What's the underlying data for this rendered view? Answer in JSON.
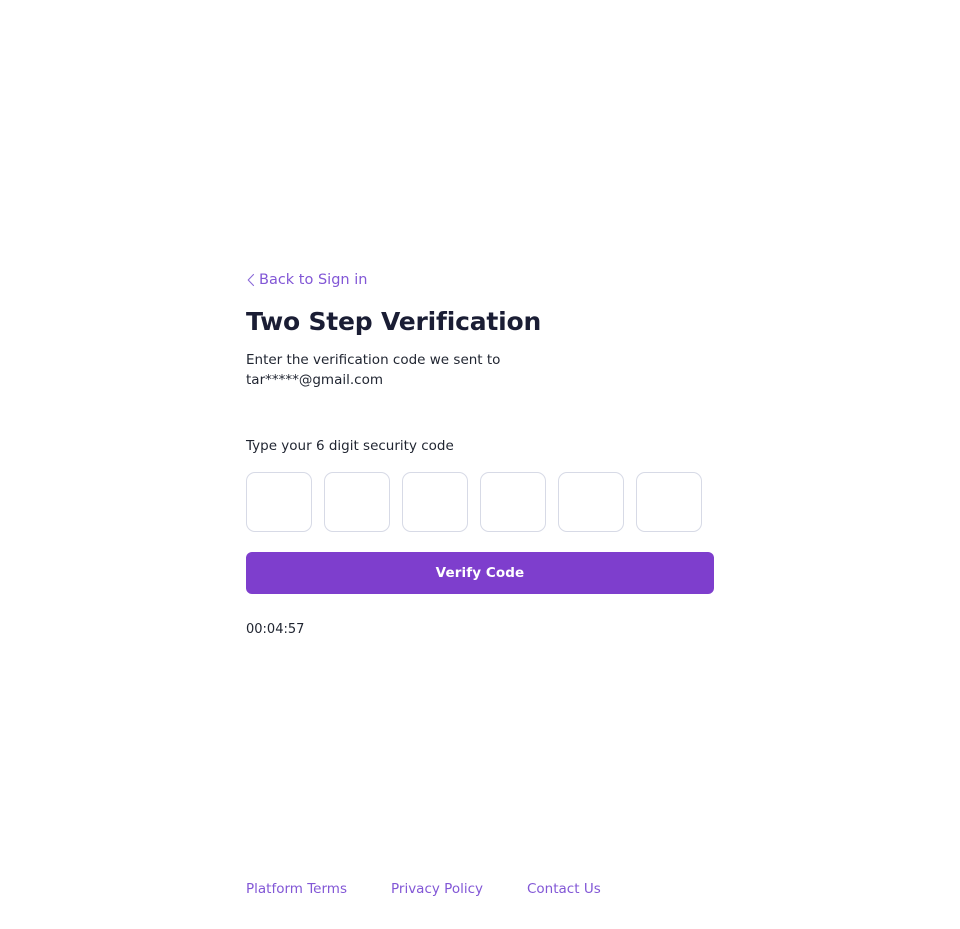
{
  "colors": {
    "accent": "#7e3ecd",
    "link": "#8257d6",
    "heading": "#1a1d34",
    "body_text": "#1f2430",
    "input_border": "#d7dae6",
    "background": "#ffffff"
  },
  "back": {
    "icon": "chevron-left-icon",
    "label": "Back to Sign in"
  },
  "heading": "Two Step Verification",
  "subtitle": {
    "line1": "Enter the verification code we sent to",
    "line2": "tar*****@gmail.com"
  },
  "code_section": {
    "label": "Type your 6 digit security code",
    "digit_count": 6,
    "digits": [
      "",
      "",
      "",
      "",
      "",
      ""
    ],
    "placeholder": ""
  },
  "verify_button": {
    "label": "Verify Code"
  },
  "timer": {
    "value": "00:04:57"
  },
  "footer": {
    "links": [
      {
        "label": "Platform Terms"
      },
      {
        "label": "Privacy Policy"
      },
      {
        "label": "Contact Us"
      }
    ]
  }
}
